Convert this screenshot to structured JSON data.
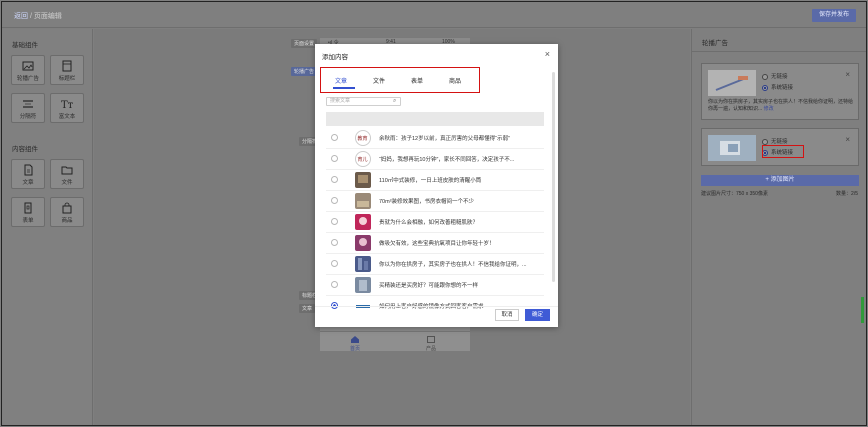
{
  "header": {
    "breadcrumb_back": "返回",
    "breadcrumb_sep": "/",
    "breadcrumb_current": "页面编辑",
    "save_label": "保存并发布"
  },
  "left_panel": {
    "basic_title": "基础组件",
    "basic_items": [
      {
        "label": "轮播广告",
        "icon": "image-icon"
      },
      {
        "label": "标题栏",
        "icon": "title-bar-icon"
      },
      {
        "label": "分隔符",
        "icon": "divider-icon"
      },
      {
        "label": "富文本",
        "icon": "rich-text-icon"
      }
    ],
    "content_title": "内容组件",
    "content_items": [
      {
        "label": "文章",
        "icon": "article-icon"
      },
      {
        "label": "文件",
        "icon": "folder-icon"
      },
      {
        "label": "表单",
        "icon": "form-icon"
      },
      {
        "label": "商品",
        "icon": "product-bag-icon"
      }
    ]
  },
  "canvas": {
    "phone_time": "9:41",
    "phone_battery": "100%",
    "phone_signal": "•ıl 令",
    "nav_home": "首页",
    "nav_products": "产品",
    "side_tags": [
      "页面设置",
      "轮播广告",
      "分隔符",
      "标题栏",
      "文章"
    ]
  },
  "right_panel": {
    "title": "轮播广告",
    "cards": [
      {
        "option_none": "无链接",
        "option_system": "系统链接",
        "selected": "系统链接",
        "description": "你以为你在拱房子，其实房子也在拱人！不信我给你证明，还特给你再一遍，认知和知识...",
        "more": "修改"
      },
      {
        "option_none": "无链接",
        "option_system": "系统链接",
        "selected": "系统链接"
      }
    ],
    "add_image_label": "+ 添加图片",
    "size_hint": "建议图片尺寸：750 x 350像素",
    "count_hint": "数量：2/5"
  },
  "modal": {
    "title": "添加内容",
    "tabs": [
      "文章",
      "文件",
      "表单",
      "商品"
    ],
    "active_tab": "文章",
    "search_placeholder": "搜索文章",
    "rows": [
      {
        "text": "余秋雨：孩子12岁以前，真正厉害的父母都懂得“示弱”",
        "selected": false
      },
      {
        "text": "“妈妈，我想再玩10分钟”，家长不同回答，决定孩子不...",
        "selected": false
      },
      {
        "text": "110㎡中式装修，一日上班皮肤的清醒小筒",
        "selected": false
      },
      {
        "text": "70m²装修效果图，书房衣帽间一个不少",
        "selected": false
      },
      {
        "text": "贵就为什么会相融，如何改善粗糙肌肤？",
        "selected": false
      },
      {
        "text": "做吸欠有效，这些宝典抗氧项目让你年轻十岁！",
        "selected": false
      },
      {
        "text": "你以为你在拱房子，其实房子也在拱人！不信我给你证明，...",
        "selected": false
      },
      {
        "text": "买精装还是买房好？可能跟你想的不一样",
        "selected": false
      },
      {
        "text": "如何用上客户好感的镜像方式回客客户需求",
        "selected": true
      }
    ],
    "cancel_label": "取消",
    "ok_label": "确定"
  }
}
